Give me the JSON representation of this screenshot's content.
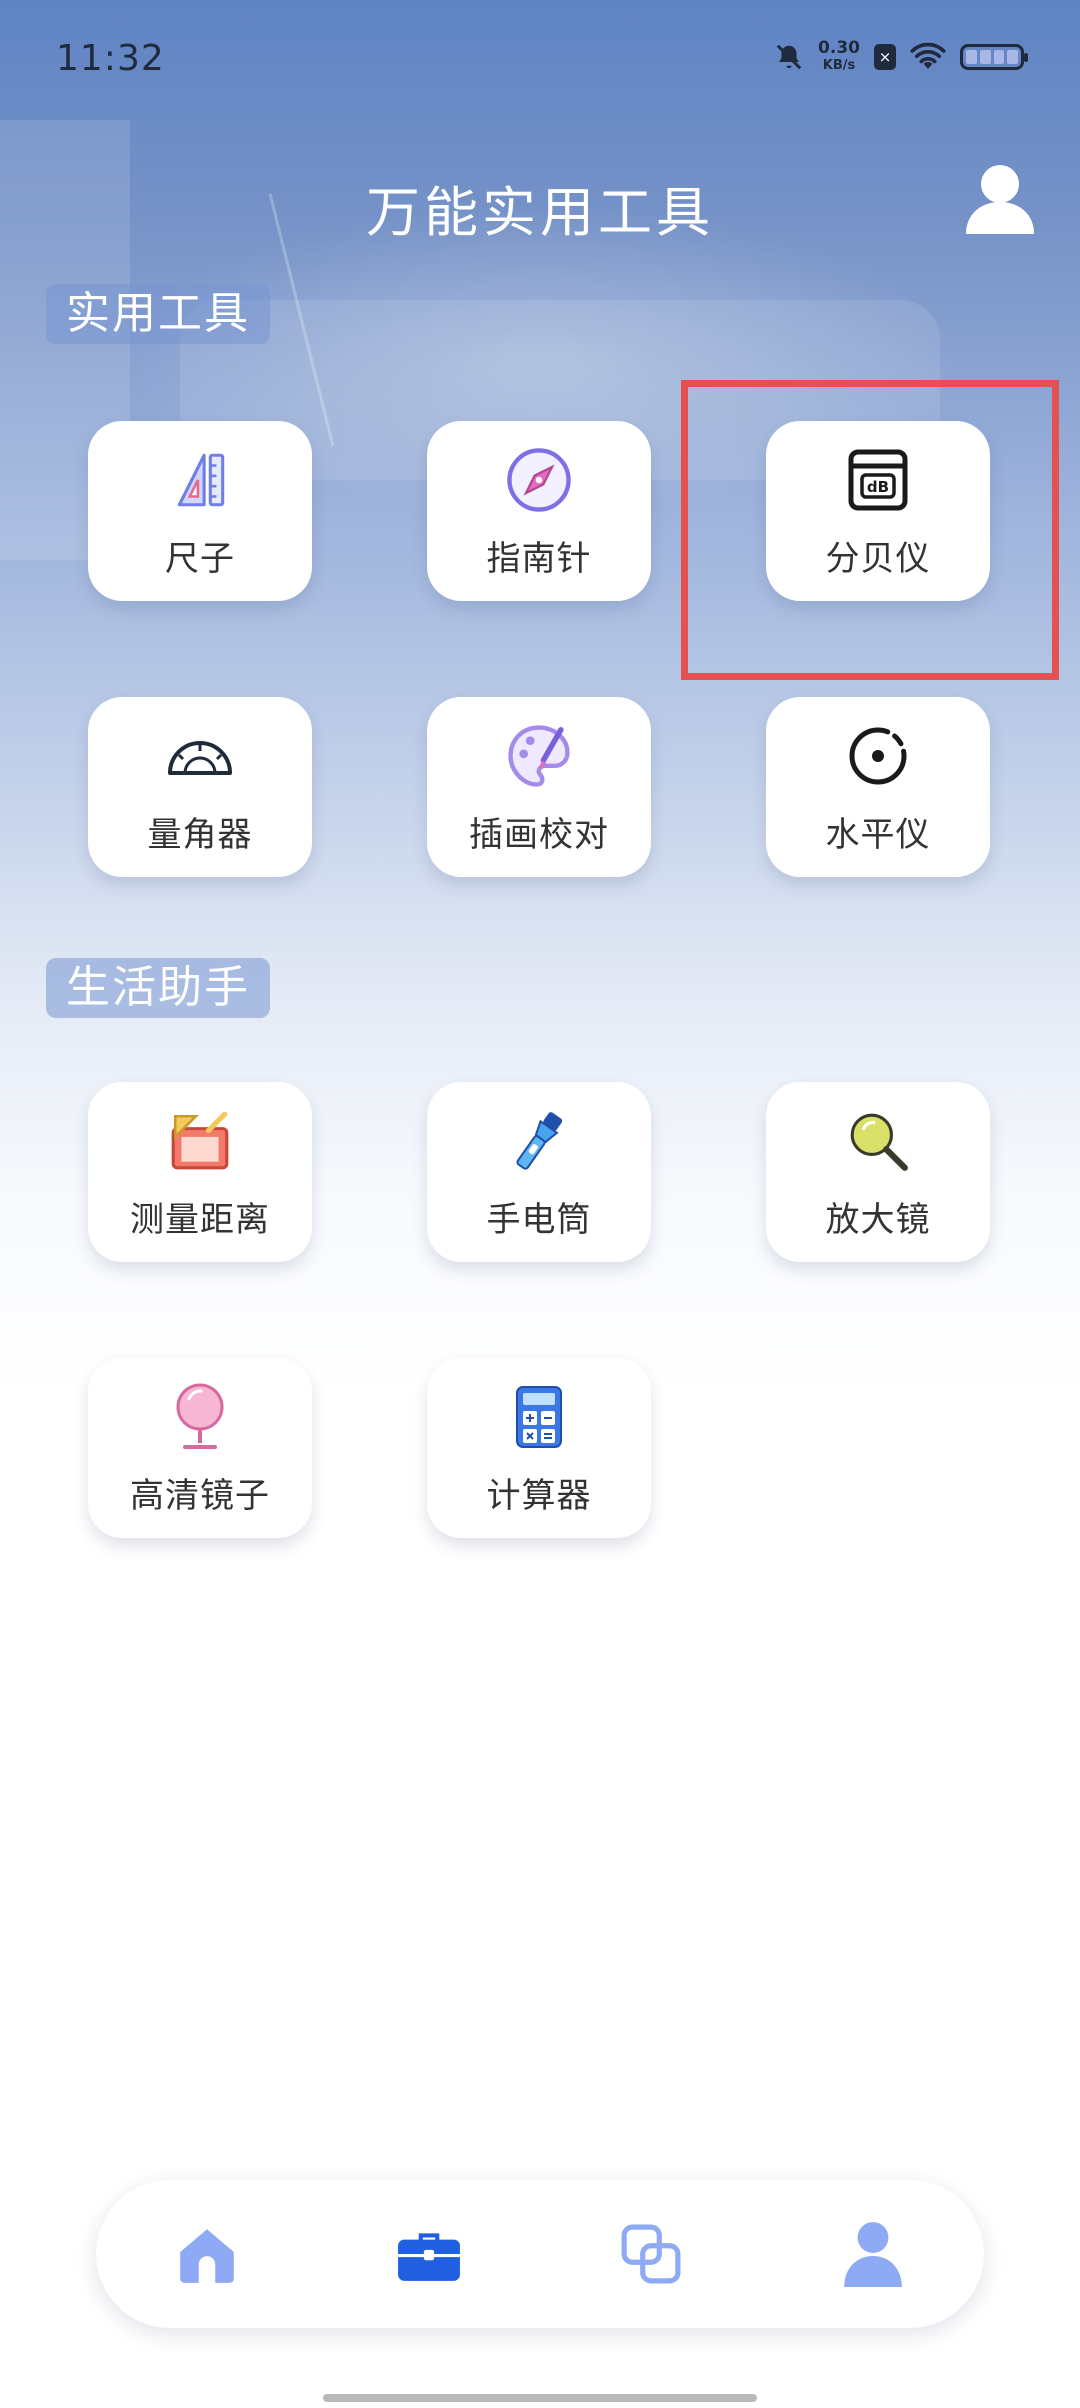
{
  "status_bar": {
    "time": "11:32",
    "net_speed": "0.30",
    "net_unit": "KB/s",
    "sim_icon_text": "×"
  },
  "header": {
    "title": "万能实用工具"
  },
  "sections": {
    "utility": {
      "title": "实用工具",
      "items": [
        {
          "label": "尺子",
          "icon": "ruler-icon"
        },
        {
          "label": "指南针",
          "icon": "compass-icon"
        },
        {
          "label": "分贝仪",
          "icon": "decibel-meter-icon",
          "badge": "dB"
        },
        {
          "label": "量角器",
          "icon": "protractor-icon"
        },
        {
          "label": "插画校对",
          "icon": "palette-icon"
        },
        {
          "label": "水平仪",
          "icon": "level-icon"
        }
      ]
    },
    "life": {
      "title": "生活助手",
      "items": [
        {
          "label": "测量距离",
          "icon": "measure-distance-icon"
        },
        {
          "label": "手电筒",
          "icon": "flashlight-icon"
        },
        {
          "label": "放大镜",
          "icon": "magnifier-icon"
        },
        {
          "label": "高清镜子",
          "icon": "mirror-icon"
        },
        {
          "label": "计算器",
          "icon": "calculator-icon"
        }
      ]
    }
  },
  "bottom_nav": [
    {
      "icon": "home-icon",
      "active": false
    },
    {
      "icon": "toolbox-icon",
      "active": true
    },
    {
      "icon": "overlap-squares-icon",
      "active": false
    },
    {
      "icon": "user-icon",
      "active": false
    }
  ],
  "colors": {
    "nav_active": "#1f5fe0",
    "nav_inactive": "#8eaaf5",
    "highlight": "#e55050",
    "section_bg": "#7896d2"
  }
}
